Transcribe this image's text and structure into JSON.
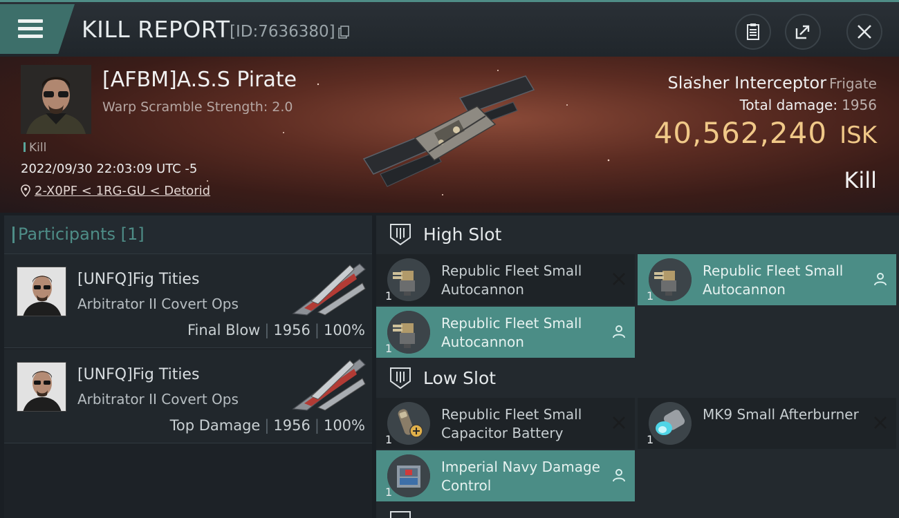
{
  "header": {
    "title": "KILL REPORT",
    "report_id": "[ID:7636380]"
  },
  "victim": {
    "name": "[AFBM]A.S.S Pirate",
    "subtitle": "Warp Scramble Strength: 2.0",
    "tag": "Kill",
    "datetime": "2022/09/30 22:03:09 UTC -5",
    "location": "2-X0PF < 1RG-GU < Detorid"
  },
  "ship": {
    "name": "Slasher Interceptor",
    "class": "Frigate",
    "total_damage_label": "Total damage:",
    "total_damage": "1956",
    "value": "40,562,240",
    "currency": "ISK",
    "result": "Kill"
  },
  "participants": {
    "label": "Participants",
    "count": "[1]",
    "rows": [
      {
        "name": "[UNFQ]Fig Tities",
        "ship": "Arbitrator II Covert Ops",
        "role": "Final Blow",
        "damage": "1956",
        "percent": "100%"
      },
      {
        "name": "[UNFQ]Fig Tities",
        "ship": "Arbitrator II Covert Ops",
        "role": "Top Damage",
        "damage": "1956",
        "percent": "100%"
      }
    ],
    "separator": "|"
  },
  "slots": {
    "high": {
      "label": "High Slot",
      "items": [
        {
          "name": "Republic Fleet Small Autocannon",
          "qty": "1",
          "status": "destroyed",
          "icon": "autocannon-icon"
        },
        {
          "name": "Republic Fleet Small Autocannon",
          "qty": "1",
          "status": "dropped",
          "icon": "autocannon-icon"
        },
        {
          "name": "Republic Fleet Small Autocannon",
          "qty": "1",
          "status": "dropped",
          "icon": "autocannon-icon"
        }
      ]
    },
    "low": {
      "label": "Low Slot",
      "items": [
        {
          "name": "Republic Fleet Small Capacitor Battery",
          "qty": "1",
          "status": "destroyed",
          "icon": "capacitor-battery-icon"
        },
        {
          "name": "MK9 Small Afterburner",
          "qty": "1",
          "status": "destroyed",
          "icon": "afterburner-icon"
        },
        {
          "name": "Imperial Navy Damage Control",
          "qty": "1",
          "status": "dropped",
          "icon": "damage-control-icon"
        }
      ]
    }
  },
  "colors": {
    "accent": "#4e8d87",
    "isk": "#f0c888",
    "dropped_bg": "#4b8d86",
    "destroyed_bg": "#1e2327"
  }
}
